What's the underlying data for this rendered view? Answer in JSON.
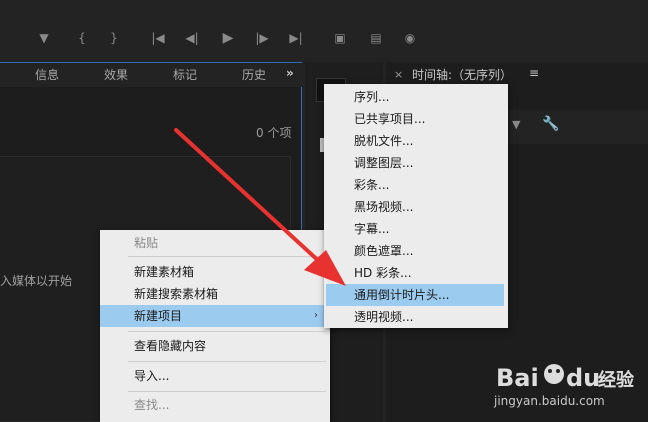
{
  "project_panel": {
    "tabs": [
      "信息",
      "效果",
      "标记",
      "历史"
    ],
    "overflow": "»",
    "item_count": "0 个项",
    "hint": "入媒体以开始"
  },
  "timeline_panel": {
    "close": "×",
    "title": "时间轴:（无序列）",
    "menu": "≡"
  },
  "context_menu": {
    "items": [
      {
        "label": "粘贴",
        "disabled": true
      },
      {
        "label": "新建素材箱"
      },
      {
        "label": "新建搜索素材箱"
      },
      {
        "label": "新建项目",
        "highlighted": true,
        "submenu": "›"
      },
      {
        "label": "查看隐藏内容"
      },
      {
        "label": "导入..."
      },
      {
        "label": "查找...",
        "disabled": true
      }
    ]
  },
  "submenu": {
    "items": [
      {
        "label": "序列..."
      },
      {
        "label": "已共享项目..."
      },
      {
        "label": "脱机文件..."
      },
      {
        "label": "调整图层..."
      },
      {
        "label": "彩条..."
      },
      {
        "label": "黑场视频..."
      },
      {
        "label": "字幕..."
      },
      {
        "label": "颜色遮罩..."
      },
      {
        "label": "HD 彩条..."
      },
      {
        "label": "通用倒计时片头...",
        "highlighted": true
      },
      {
        "label": "透明视频..."
      }
    ]
  },
  "toolbar_icons": [
    "marker-icon",
    "in-point-icon",
    "out-point-icon",
    "go-to-in-icon",
    "step-back-icon",
    "play-icon",
    "step-forward-icon",
    "go-to-out-icon",
    "insert-icon",
    "overwrite-icon",
    "camera-icon"
  ],
  "watermark": {
    "logo_text": "Bai du 经验",
    "url": "jingyan.baidu.com"
  },
  "colors": {
    "panel_bg": "#1d1d1d",
    "focus_border": "#2f6fb3",
    "menu_bg": "#ececec",
    "menu_highlight": "#9ccbf0",
    "arrow": "#e8322f"
  }
}
